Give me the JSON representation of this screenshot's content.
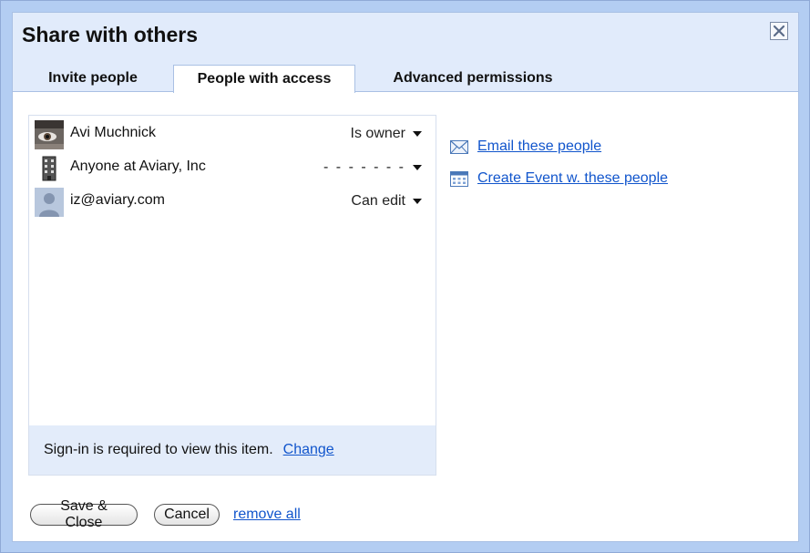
{
  "dialog": {
    "title": "Share with others"
  },
  "tabs": [
    {
      "label": "Invite people",
      "active": false
    },
    {
      "label": "People with access",
      "active": true
    },
    {
      "label": "Advanced permissions",
      "active": false
    }
  ],
  "people": [
    {
      "name": "Avi Muchnick",
      "permission": "Is owner",
      "avatar": "face-photo"
    },
    {
      "name": "Anyone at Aviary, Inc",
      "permission": "- - - - - - -",
      "avatar": "building-icon"
    },
    {
      "name": "iz@aviary.com",
      "permission": "Can edit",
      "avatar": "default-user-icon"
    }
  ],
  "signin": {
    "text": "Sign-in is required to view this item.",
    "link": "Change"
  },
  "actions": {
    "email": "Email these people",
    "event": "Create Event w. these people"
  },
  "footer": {
    "save": "Save & Close",
    "cancel": "Cancel",
    "remove_all": "remove all"
  },
  "colors": {
    "frame": "#b3cdf2",
    "header": "#e1ebfb",
    "link": "#1155cc",
    "signin_bg": "#e3ecfa"
  }
}
